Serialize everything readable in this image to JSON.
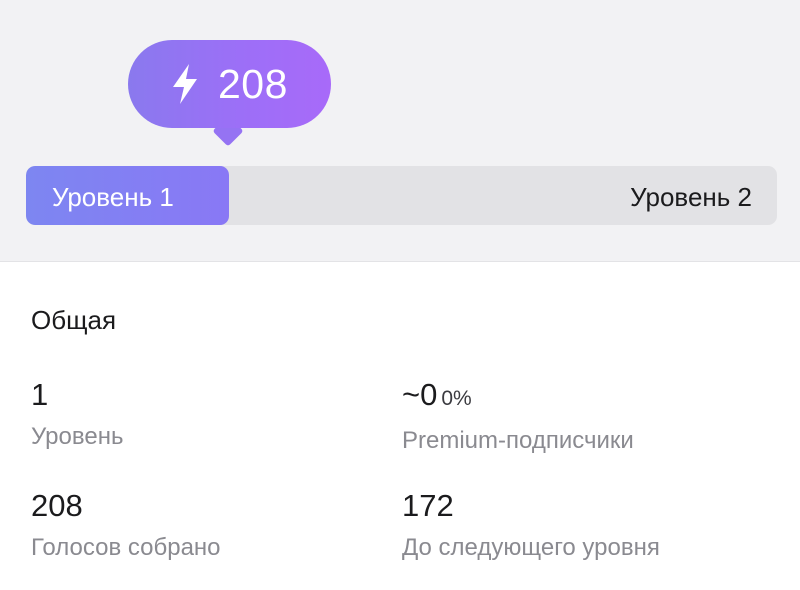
{
  "boost": {
    "icon": "lightning-icon",
    "count": "208"
  },
  "levels": {
    "current_label": "Уровень 1",
    "next_label": "Уровень 2",
    "progress": 0.27
  },
  "section": {
    "title": "Общая"
  },
  "stats": {
    "level": {
      "value": "1",
      "label": "Уровень"
    },
    "premium": {
      "value": "~0",
      "percent": "0%",
      "label": "Premium-подписчики"
    },
    "votes": {
      "value": "208",
      "label": "Голосов собрано"
    },
    "to_next": {
      "value": "172",
      "label": "До следующего уровня"
    }
  },
  "colors": {
    "accent_start": "#7d86f1",
    "accent_end": "#a86af9",
    "muted_text": "#8a8a90"
  }
}
